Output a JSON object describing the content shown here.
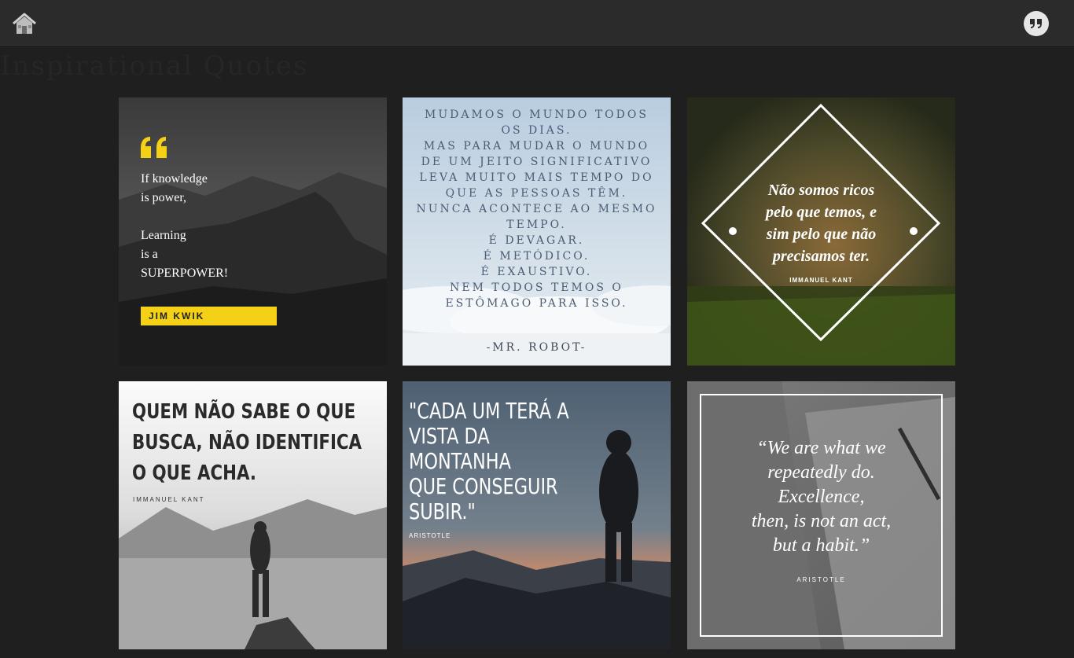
{
  "header": {
    "home_icon": "home-icon",
    "quote_icon": "quote-icon",
    "ghost_title": "Inspirational Quotes"
  },
  "colors": {
    "topbar": "#2b2b2b",
    "page_background": "#1f1f1f",
    "accent_yellow": "#f4d116"
  },
  "cards": [
    {
      "text": "If knowledge\nis power,\n\nLearning\nis a\nSUPERPOWER!",
      "author": "JIM KWIK"
    },
    {
      "text": "MUDAMOS O MUNDO TODOS\nOS DIAS.\nMAS PARA MUDAR O MUNDO\nDE UM JEITO SIGNIFICATIVO\nLEVA MUITO MAIS TEMPO DO\nQUE AS PESSOAS TÊM.\nNUNCA ACONTECE AO MESMO\nTEMPO.\nÉ DEVAGAR.\nÉ METÓDICO.\nÉ EXAUSTIVO.\nNEM TODOS TEMOS O\nESTÔMAGO PARA ISSO.",
      "author": "-MR. ROBOT-"
    },
    {
      "text": "Não somos ricos\npelo que temos, e\nsim pelo que não\nprecisamos ter.",
      "author": "IMMANUEL KANT"
    },
    {
      "text": "QUEM NÃO SABE O QUE\nBUSCA, NÃO IDENTIFICA\nO QUE ACHA.",
      "author": "IMMANUEL KANT"
    },
    {
      "text": "\"CADA UM TERÁ A\nVISTA DA\nMONTANHA\nQUE CONSEGUIR\nSUBIR.\"",
      "author": "ARISTOTLE"
    },
    {
      "text": "“We are what we\nrepeatedly do.\nExcellence,\nthen, is not an act,\nbut a habit.”",
      "author": "ARISTOTLE"
    }
  ]
}
